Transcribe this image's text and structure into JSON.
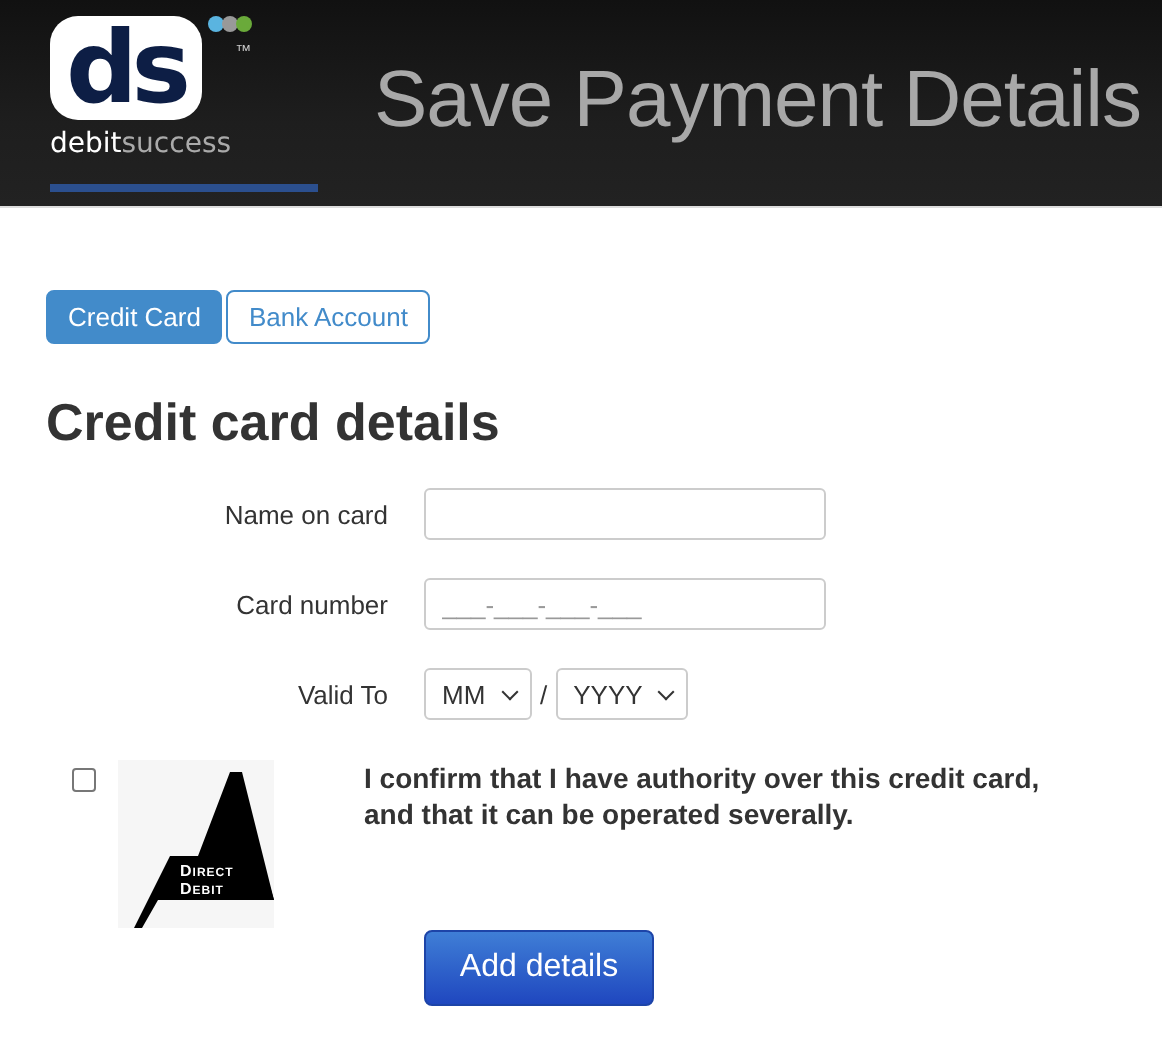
{
  "header": {
    "logo": {
      "mark": "ds",
      "trademark": "™",
      "word_1": "debit",
      "word_2": "success"
    },
    "title": "Save Payment Details"
  },
  "tabs": [
    {
      "label": "Credit Card",
      "selected": true
    },
    {
      "label": "Bank Account",
      "selected": false
    }
  ],
  "heading": "Credit card details",
  "fields": [
    {
      "kind": "text",
      "label": "Name on card"
    },
    {
      "kind": "text",
      "label": "Card number",
      "placeholder": "___-___-___-___"
    },
    {
      "kind": "date",
      "label": "Valid To",
      "month": "MM",
      "separator": "/",
      "year": "YYYY"
    }
  ],
  "consent": {
    "checked": false,
    "badge": {
      "line_1": "Direct",
      "line_2": "Debit"
    },
    "text": "I confirm that I have authority over this credit card, and that it can be operated severally."
  },
  "submit": "Add details"
}
